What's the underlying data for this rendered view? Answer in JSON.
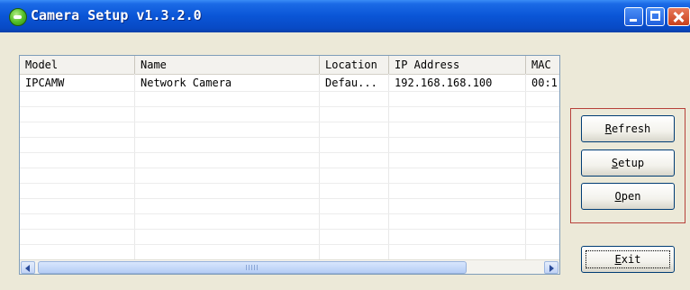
{
  "window": {
    "title": "Camera Setup v1.3.2.0",
    "icon": "camera-app-icon",
    "controls": [
      "minimize",
      "maximize",
      "close"
    ]
  },
  "list": {
    "columns": [
      "Model",
      "Name",
      "Location",
      "IP Address",
      "MAC"
    ],
    "rows": [
      [
        "IPCAMW",
        "Network Camera",
        "Defau...",
        "192.168.168.100",
        "00:1"
      ]
    ]
  },
  "buttons": {
    "refresh": {
      "hotkey": "R",
      "rest": "efresh"
    },
    "setup": {
      "hotkey": "S",
      "rest": "etup"
    },
    "open": {
      "hotkey": "O",
      "rest": "pen"
    },
    "exit": {
      "hotkey": "E",
      "rest": "xit"
    }
  },
  "colors": {
    "titlebar": "#0a55d6",
    "group_border": "#b7413a",
    "window_bg": "#ece9d8"
  }
}
